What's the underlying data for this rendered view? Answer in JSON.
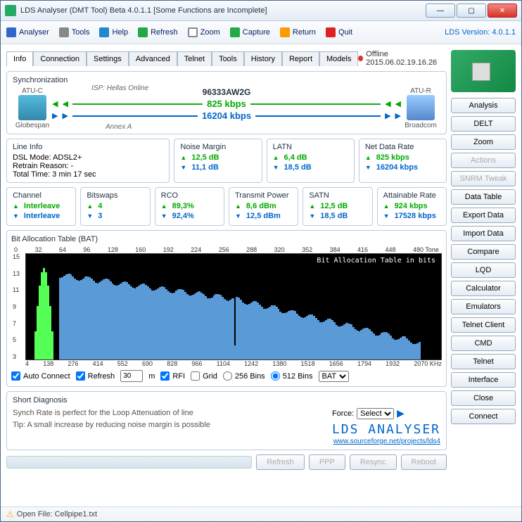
{
  "titlebar": {
    "title": "LDS Analyser (DMT Tool) Beta 4.0.1.1 [Some Functions are Incomplete]"
  },
  "toolbar": {
    "analyser": "Analyser",
    "tools": "Tools",
    "help": "Help",
    "refresh": "Refresh",
    "zoom": "Zoom",
    "capture": "Capture",
    "return": "Return",
    "quit": "Quit",
    "version": "LDS Version: 4.0.1.1"
  },
  "tabs": {
    "items": [
      "Info",
      "Connection",
      "Settings",
      "Advanced",
      "Telnet",
      "Tools",
      "History",
      "Report",
      "Models"
    ],
    "active": 0,
    "offline": "Offline 2015.06.02.19.16.26"
  },
  "sync": {
    "title": "Synchronization",
    "chip": "96333AW2G",
    "atu_c": "ATU-C",
    "atu_r": "ATU-R",
    "globespan": "Globespan",
    "broadcom": "Broadcom",
    "isp": "ISP: Hellas Online",
    "annex": "Annex A",
    "up_rate": "825 kbps",
    "dn_rate": "16204 kbps"
  },
  "lineinfo": {
    "title": "Line Info",
    "mode": "DSL Mode: ADSL2+",
    "retrain": "Retrain Reason: -",
    "total": "Total Time: 3 min 17 sec"
  },
  "nm": {
    "title": "Noise Margin",
    "up": "12,5 dB",
    "dn": "11,1 dB"
  },
  "latn": {
    "title": "LATN",
    "up": "6,4 dB",
    "dn": "18,5 dB"
  },
  "ndr": {
    "title": "Net Data Rate",
    "up": "825 kbps",
    "dn": "16204 kbps"
  },
  "ch": {
    "title": "Channel",
    "up": "Interleave",
    "dn": "Interleave"
  },
  "bs": {
    "title": "Bitswaps",
    "up": "4",
    "dn": "3"
  },
  "rco": {
    "title": "RCO",
    "up": "89,3%",
    "dn": "92,4%"
  },
  "tp": {
    "title": "Transmit Power",
    "up": "8,6 dBm",
    "dn": "12,5 dBm"
  },
  "satn": {
    "title": "SATN",
    "up": "12,5 dB",
    "dn": "18,5 dB"
  },
  "ar": {
    "title": "Attainable Rate",
    "up": "924 kbps",
    "dn": "17528 kbps"
  },
  "chart": {
    "title": "Bit Allocation Table (BAT)",
    "inner": "Bit Allocation Table in bits",
    "xtop": [
      "0",
      "32",
      "64",
      "96",
      "128",
      "160",
      "192",
      "224",
      "256",
      "288",
      "320",
      "352",
      "384",
      "416",
      "448",
      "480 Tone"
    ],
    "ylabels": [
      "15",
      "13",
      "11",
      "9",
      "7",
      "5",
      "3"
    ],
    "xbot": [
      "4",
      "138",
      "276",
      "414",
      "552",
      "690",
      "828",
      "966",
      "1104",
      "1242",
      "1380",
      "1518",
      "1656",
      "1794",
      "1932",
      "2070 KHz"
    ],
    "opts": {
      "auto": "Auto Connect",
      "refresh": "Refresh",
      "refval": "30",
      "m": "m",
      "rfi": "RFI",
      "grid": "Grid",
      "b256": "256 Bins",
      "b512": "512 Bins",
      "sel": "BAT"
    }
  },
  "diag": {
    "title": "Short Diagnosis",
    "l1": "Synch Rate is perfect for the Loop Attenuation of line",
    "l2": "Tip: A small increase by reducing noise margin is possible",
    "force": "Force:",
    "sel": "Select",
    "logo": "LDS ANALYSER",
    "link": "www.sourceforge.net/projects/lds4"
  },
  "bottom": {
    "refresh": "Refresh",
    "ppp": "PPP",
    "resync": "Resync",
    "reboot": "Reboot"
  },
  "side": [
    "Analysis",
    "DELT",
    "Zoom",
    "Actions",
    "SNRM Tweak",
    "Data Table",
    "Export Data",
    "Import Data",
    "Compare",
    "LQD",
    "Calculator",
    "Emulators",
    "Telnet Client",
    "CMD",
    "Telnet",
    "Interface",
    "Close",
    "Connect"
  ],
  "side_disabled": [
    3,
    4
  ],
  "status": {
    "text": "Open File: Cellpipe1.txt"
  },
  "chart_data": {
    "type": "bar",
    "title": "Bit Allocation Table (BAT)",
    "xlabel": "Tone / KHz",
    "ylabel": "bits",
    "xlim": [
      0,
      512
    ],
    "ylim": [
      0,
      15
    ],
    "upstream_range": [
      6,
      32
    ],
    "downstream_range": [
      33,
      480
    ],
    "values_sample": {
      "green_peak": 13,
      "downstream_plateau_start": 12,
      "downstream_end": 5
    }
  }
}
